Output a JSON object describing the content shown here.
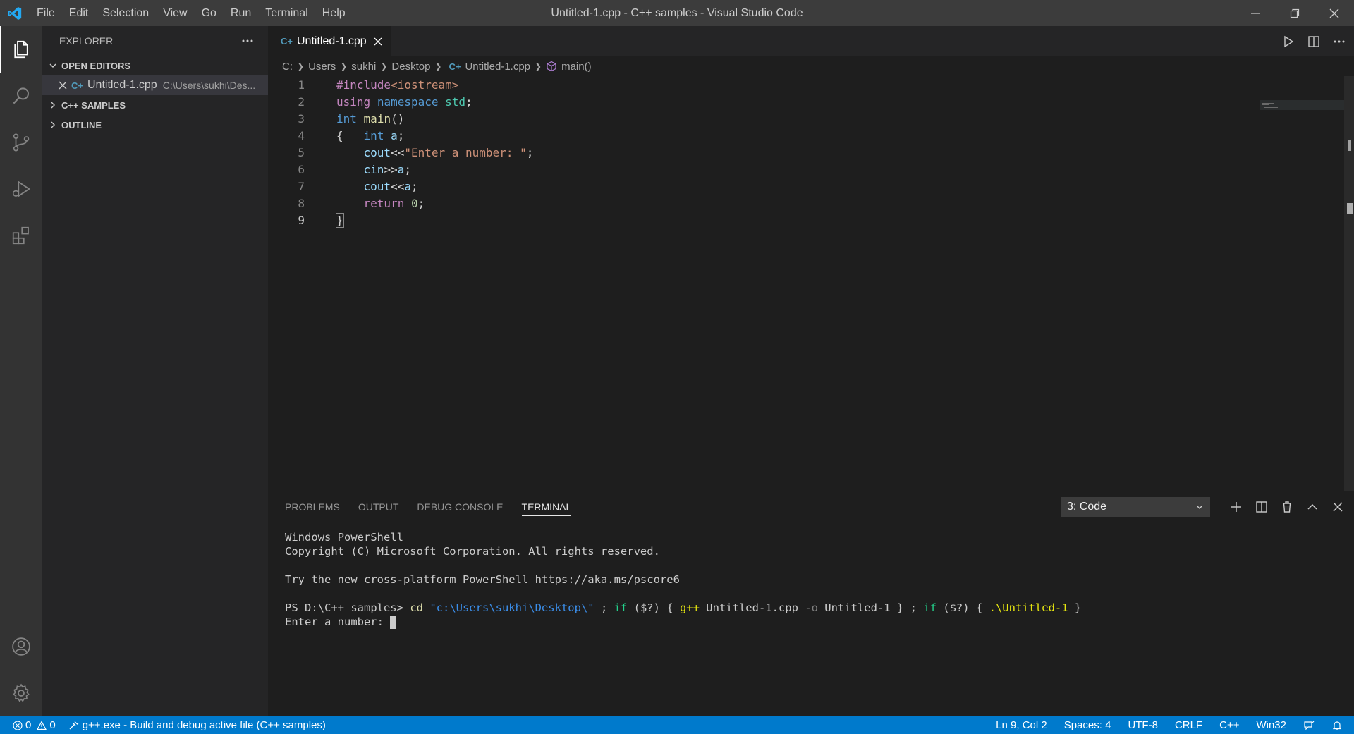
{
  "window": {
    "title": "Untitled-1.cpp - C++ samples - Visual Studio Code",
    "menu": [
      "File",
      "Edit",
      "Selection",
      "View",
      "Go",
      "Run",
      "Terminal",
      "Help"
    ]
  },
  "activity_bar": {
    "items": [
      "explorer-icon",
      "search-icon",
      "source-control-icon",
      "run-debug-icon",
      "extensions-icon"
    ],
    "bottom": [
      "account-icon",
      "gear-icon"
    ]
  },
  "sidebar": {
    "header": "EXPLORER",
    "open_editors_label": "OPEN EDITORS",
    "open_editor": {
      "name": "Untitled-1.cpp",
      "path": "C:\\Users\\sukhi\\Des..."
    },
    "samples_label": "C++ SAMPLES",
    "outline_label": "OUTLINE"
  },
  "editor": {
    "tab": "Untitled-1.cpp",
    "cpp_glyph": "C+",
    "breadcrumb": [
      "C:",
      "Users",
      "sukhi",
      "Desktop",
      "Untitled-1.cpp",
      "main()"
    ],
    "line_numbers": [
      "1",
      "2",
      "3",
      "4",
      "5",
      "6",
      "7",
      "8",
      "9"
    ],
    "code": {
      "l1_pp": "#include",
      "l1_hdr": "<iostream>",
      "l2_using": "using",
      "l2_ns": "namespace",
      "l2_std": "std",
      "l2_end": ";",
      "l3_int": "int",
      "l3_main": "main",
      "l3_paren": "()",
      "l4_brace": "{",
      "l4_int": "int",
      "l4_a": "a",
      "l4_end": ";",
      "l5_cout": "cout",
      "l5_op": "<<",
      "l5_str": "\"Enter a number: \"",
      "l5_end": ";",
      "l6_cin": "cin",
      "l6_op": ">>",
      "l6_a": "a",
      "l6_end": ";",
      "l7_cout": "cout",
      "l7_op": "<<",
      "l7_a": "a",
      "l7_end": ";",
      "l8_return": "return",
      "l8_zero": "0",
      "l8_end": ";",
      "l9_brace": "}"
    }
  },
  "panel": {
    "tabs": [
      "PROBLEMS",
      "OUTPUT",
      "DEBUG CONSOLE",
      "TERMINAL"
    ],
    "active_tab": "TERMINAL",
    "terminal_select": "3: Code",
    "lines": {
      "l1": "Windows PowerShell",
      "l2": "Copyright (C) Microsoft Corporation. All rights reserved.",
      "l3": "Try the new cross-platform PowerShell https://aka.ms/pscore6",
      "prompt": "PS D:\\C++ samples> ",
      "cmd_cd": "cd",
      "cmd_path": "\"c:\\Users\\sukhi\\Desktop\\\"",
      "cmd_semi1": " ; ",
      "cmd_if1": "if",
      "cmd_cond1": " ($?) { ",
      "cmd_gpp": "g++",
      "cmd_file": " Untitled-1.cpp ",
      "cmd_o": "-o",
      "cmd_out": " Untitled-1 } ; ",
      "cmd_if2": "if",
      "cmd_cond2": " ($?) { ",
      "cmd_run": ".\\Untitled-1",
      "cmd_close": " }",
      "input_prompt": "Enter a number: "
    }
  },
  "status_bar": {
    "errors": "0",
    "warnings": "0",
    "task": "g++.exe - Build and debug active file (C++ samples)",
    "position": "Ln 9, Col 2",
    "spaces": "Spaces: 4",
    "encoding": "UTF-8",
    "eol": "CRLF",
    "language": "C++",
    "platform": "Win32"
  },
  "colors": {
    "statusbar": "#007acc",
    "accent_blue": "#007acc",
    "titlebar": "#3c3c3c"
  }
}
